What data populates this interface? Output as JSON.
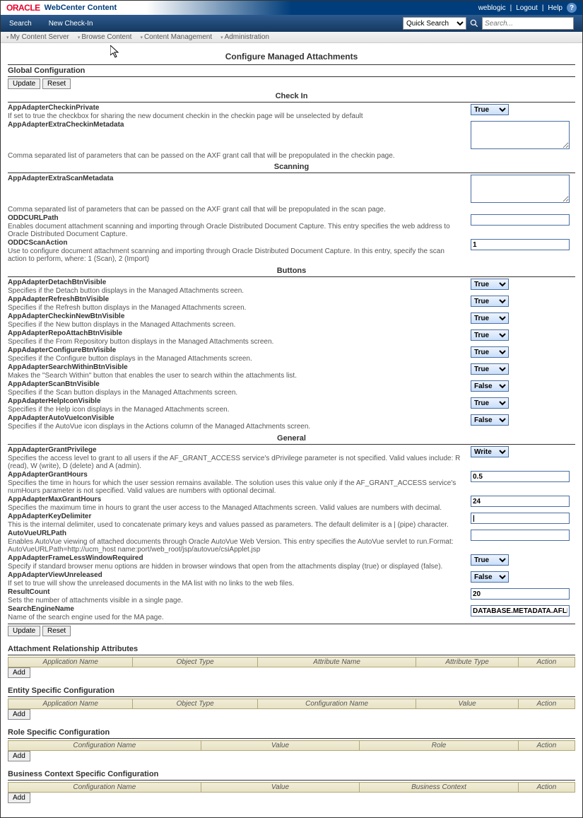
{
  "header": {
    "brand1": "ORACLE",
    "brand2": "WebCenter Content",
    "user": "weblogic",
    "logout": "Logout",
    "help": "Help"
  },
  "topbar": {
    "search": "Search",
    "newcheckin": "New Check-In",
    "quick_search_sel": "Quick Search",
    "search_placeholder": "Search..."
  },
  "menubar": {
    "m1": "My Content Server",
    "m2": "Browse Content",
    "m3": "Content Management",
    "m4": "Administration"
  },
  "page_title": "Configure Managed Attachments",
  "global_cfg": "Global Configuration",
  "btn_update": "Update",
  "btn_reset": "Reset",
  "btn_add": "Add",
  "groups": {
    "checkin": "Check In",
    "scanning": "Scanning",
    "buttons": "Buttons",
    "general": "General"
  },
  "f": {
    "AppAdapterCheckinPrivate": {
      "label": "AppAdapterCheckinPrivate",
      "desc": "If set to true the checkbox for sharing the new document checkin in the checkin page will be unselected by default",
      "val": "True"
    },
    "AppAdapterExtraCheckinMetadata": {
      "label": "AppAdapterExtraCheckinMetadata",
      "desc": "Comma separated list of parameters that can be passed on the AXF grant call that will be prepopulated in the checkin page."
    },
    "AppAdapterExtraScanMetadata": {
      "label": "AppAdapterExtraScanMetadata",
      "desc": "Comma separated list of parameters that can be passed on the AXF grant call that will be prepopulated in the scan page."
    },
    "ODDCURLPath": {
      "label": "ODDCURLPath",
      "desc": "Enables document attachment scanning and importing through Oracle Distributed Document Capture. This entry specifies the web address to Oracle Distributed Document Capture."
    },
    "ODDCScanAction": {
      "label": "ODDCScanAction",
      "desc": "Use to configure document attachment scanning and importing through Oracle Distributed Document Capture. In this entry, specify the scan action to perform, where: 1 (Scan), 2 (Import)",
      "val": "1"
    },
    "AppAdapterDetachBtnVisible": {
      "label": "AppAdapterDetachBtnVisible",
      "desc": "Specifies if the Detach button displays in the Managed Attachments screen.",
      "val": "True"
    },
    "AppAdapterRefreshBtnVisible": {
      "label": "AppAdapterRefreshBtnVisible",
      "desc": "Specifies if the Refresh button displays in the Managed Attachments screen.",
      "val": "True"
    },
    "AppAdapterCheckinNewBtnVisible": {
      "label": "AppAdapterCheckinNewBtnVisible",
      "desc": "Specifies if the New button displays in the Managed Attachments screen.",
      "val": "True"
    },
    "AppAdapterRepoAttachBtnVisible": {
      "label": "AppAdapterRepoAttachBtnVisible",
      "desc": "Specifies if the From Repository button displays in the Managed Attachments screen.",
      "val": "True"
    },
    "AppAdapterConfigureBtnVisible": {
      "label": "AppAdapterConfigureBtnVisible",
      "desc": "Specifies if the Configure button displays in the Managed Attachments screen.",
      "val": "True"
    },
    "AppAdapterSearchWithinBtnVisible": {
      "label": "AppAdapterSearchWithinBtnVisible",
      "desc": "Makes the \"Search Within\" button that enables the user to search within the attachments list.",
      "val": "True"
    },
    "AppAdapterScanBtnVisible": {
      "label": "AppAdapterScanBtnVisible",
      "desc": "Specifies if the Scan button displays in the Managed Attachments screen.",
      "val": "False"
    },
    "AppAdapterHelpIconVisible": {
      "label": "AppAdapterHelpIconVisible",
      "desc": "Specifies if the Help icon displays in the Managed Attachments screen.",
      "val": "True"
    },
    "AppAdapterAutoVueIconVisible": {
      "label": "AppAdapterAutoVueIconVisible",
      "desc": "Specifies if the AutoVue icon displays in the Actions column of the Managed Attachments screen.",
      "val": "False"
    },
    "AppAdapterGrantPrivilege": {
      "label": "AppAdapterGrantPrivilege",
      "desc": "Specifies the access level to grant to all users if the AF_GRANT_ACCESS service's dPrivilege parameter is not specified. Valid values include: R (read), W (write), D (delete) and A (admin).",
      "val": "Write"
    },
    "AppAdapterGrantHours": {
      "label": "AppAdapterGrantHours",
      "desc": "Specifies the time in hours for which the user session remains available. The solution uses this value only if the AF_GRANT_ACCESS service's numHours parameter is not specified. Valid values are numbers with optional decimal.",
      "val": "0.5"
    },
    "AppAdapterMaxGrantHours": {
      "label": "AppAdapterMaxGrantHours",
      "desc": "Specifies the maximum time in hours to grant the user access to the Managed Attachments screen. Valid values are numbers with decimal.",
      "val": "24"
    },
    "AppAdapterKeyDelimiter": {
      "label": "AppAdapterKeyDelimiter",
      "desc": "This is the internal delimiter, used to concatenate primary keys and values passed as parameters. The default delimiter is a | (pipe) character.",
      "val": "|"
    },
    "AutoVueURLPath": {
      "label": "AutoVueURLPath",
      "desc": "Enables AutoVue viewing of attached documents through Oracle AutoVue Web Version. This entry specifies the AutoVue servlet to run.Format: AutoVueURLPath=http://ucm_host name:port/web_root/jsp/autovue/csiApplet.jsp"
    },
    "AppAdapterFrameLessWindowRequired": {
      "label": "AppAdapterFrameLessWindowRequired",
      "desc": "Specify if standard browser menu options are hidden in browser windows that open from the attachments display (true) or displayed (false).",
      "val": "True"
    },
    "AppAdapterViewUnreleased": {
      "label": "AppAdapterViewUnreleased",
      "desc": "If set to true will show the unreleased documents in the MA list with no links to the web files.",
      "val": "False"
    },
    "ResultCount": {
      "label": "ResultCount",
      "desc": "Sets the number of attachments visible in a single page.",
      "val": "20"
    },
    "SearchEngineName": {
      "label": "SearchEngineName",
      "desc": "Name of the search engine used for the MA page.",
      "val": "DATABASE.METADATA.AFLIST"
    }
  },
  "tables": {
    "attach_rel": {
      "title": "Attachment Relationship Attributes",
      "cols": [
        "Application Name",
        "Object Type",
        "Attribute Name",
        "Attribute Type",
        "Action"
      ]
    },
    "entity": {
      "title": "Entity Specific Configuration",
      "cols": [
        "Application Name",
        "Object Type",
        "Configuration Name",
        "Value",
        "Action"
      ]
    },
    "role": {
      "title": "Role Specific Configuration",
      "cols": [
        "Configuration Name",
        "Value",
        "Role",
        "Action"
      ]
    },
    "bizctx": {
      "title": "Business Context Specific Configuration",
      "cols": [
        "Configuration Name",
        "Value",
        "Business Context",
        "Action"
      ]
    }
  }
}
